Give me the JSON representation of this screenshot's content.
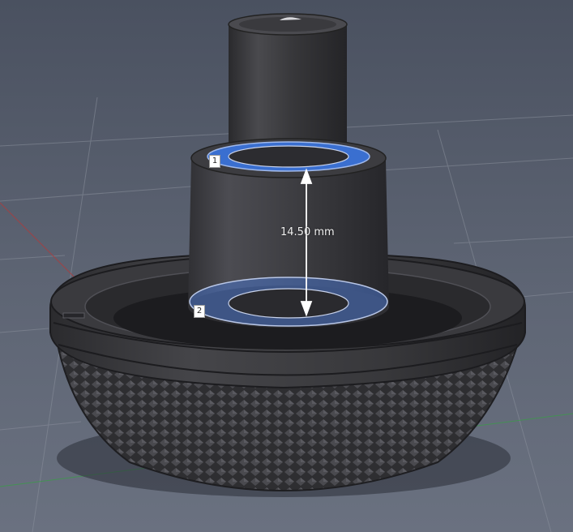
{
  "viewport": {
    "background_top": "#4a5160",
    "background_bottom": "#6a7180",
    "model_color": "#3b3b3e",
    "highlight_color": "#3a6fd0"
  },
  "measurement": {
    "value_label": "14.50 mm",
    "point_1": "1",
    "point_2": "2"
  }
}
